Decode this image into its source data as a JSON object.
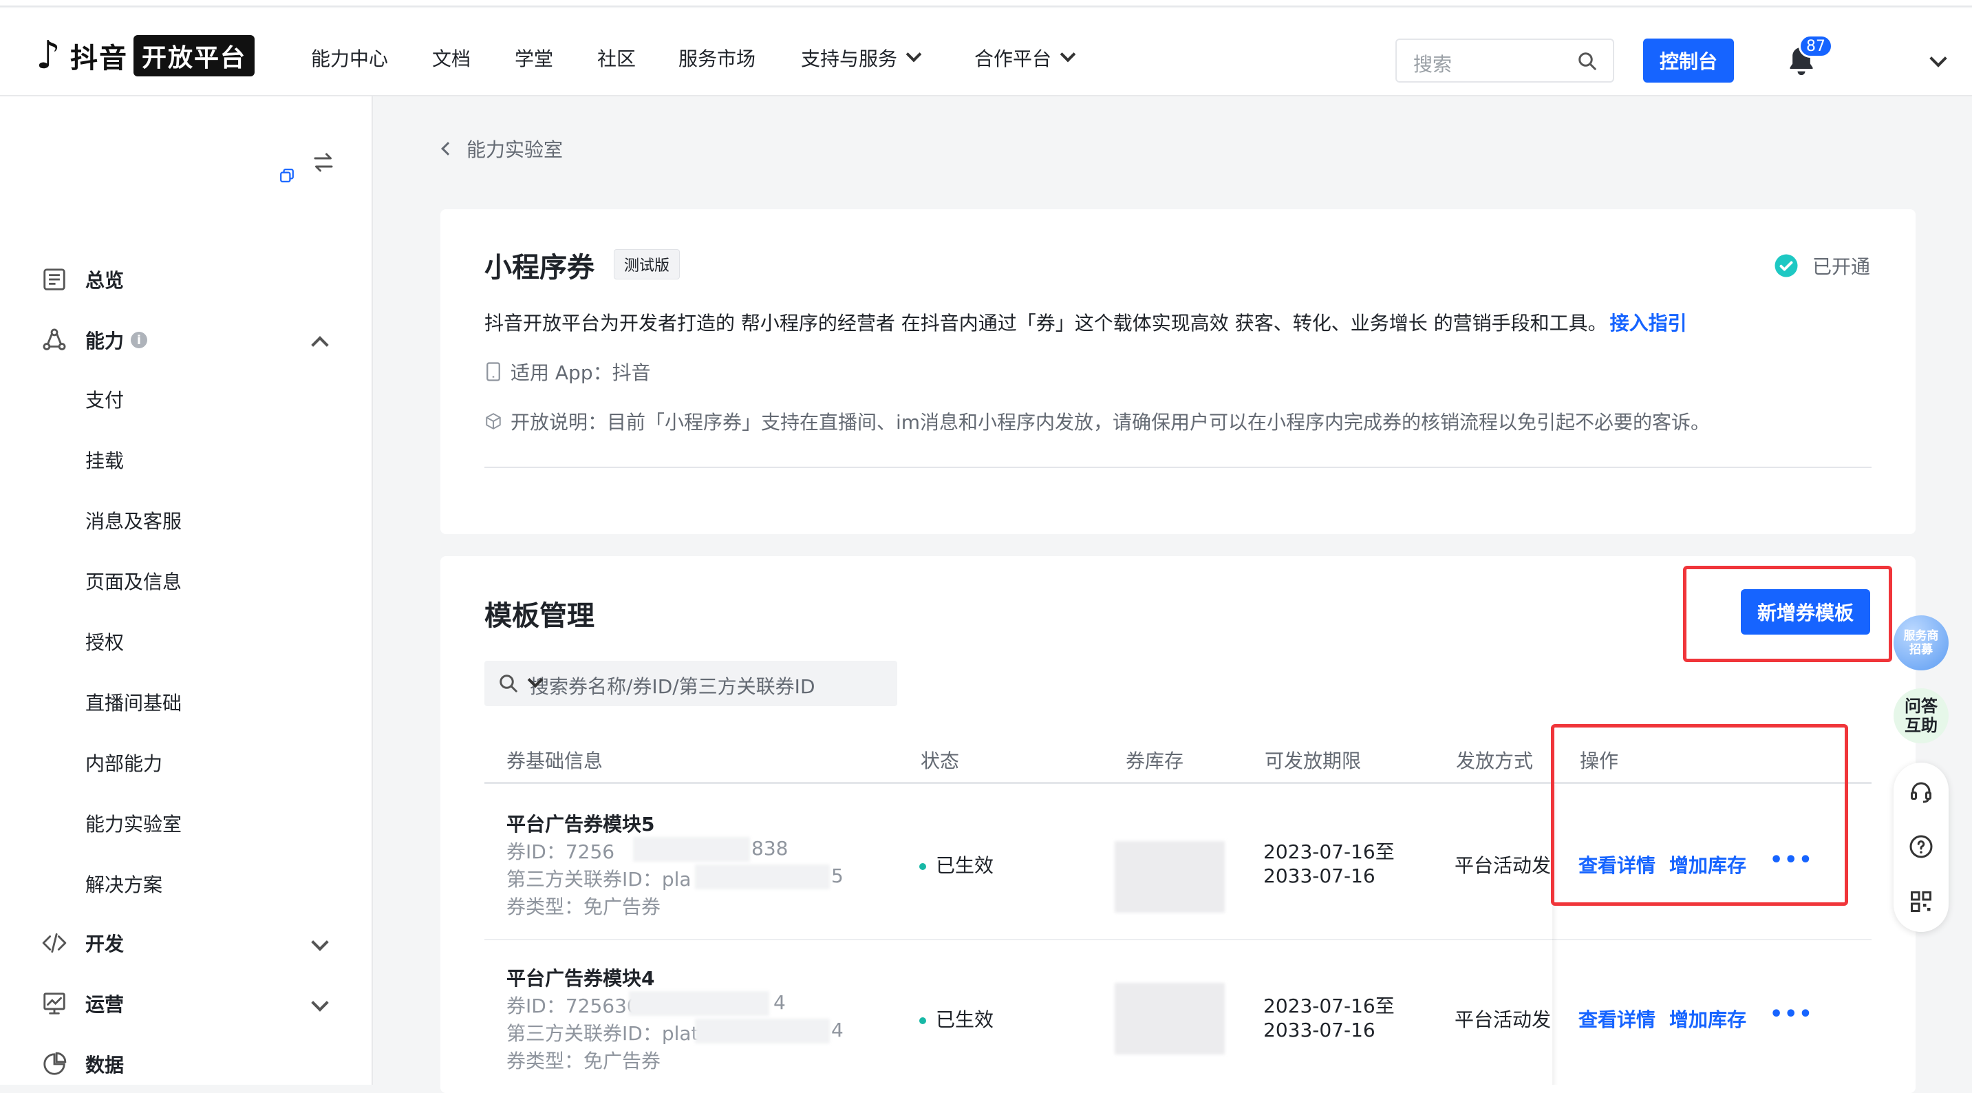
{
  "header": {
    "logo_text": "抖音",
    "logo_badge": "开放平台",
    "nav": [
      {
        "label": "能力中心"
      },
      {
        "label": "文档"
      },
      {
        "label": "学堂"
      },
      {
        "label": "社区"
      },
      {
        "label": "服务市场"
      },
      {
        "label": "支持与服务",
        "dropdown": true
      },
      {
        "label": "合作平台",
        "dropdown": true
      }
    ],
    "search_placeholder": "搜索",
    "console_button": "控制台",
    "notification_count": "87"
  },
  "sidebar": {
    "items": [
      {
        "label": "总览",
        "icon": "dashboard-icon"
      },
      {
        "label": "能力",
        "icon": "capability-icon",
        "expanded": true
      },
      {
        "label": "开发",
        "icon": "code-icon"
      },
      {
        "label": "运营",
        "icon": "operation-icon"
      },
      {
        "label": "数据",
        "icon": "pie-chart-icon"
      }
    ],
    "sub_items": [
      "支付",
      "挂载",
      "消息及客服",
      "页面及信息",
      "授权",
      "直播间基础",
      "内部能力",
      "能力实验室",
      "解决方案"
    ]
  },
  "breadcrumb": {
    "back_label": "能力实验室"
  },
  "intro": {
    "title": "小程序券",
    "tag": "测试版",
    "status": "已开通",
    "description": "抖音开放平台为开发者打造的 帮小程序的经营者 在抖音内通过「券」这个载体实现高效 获客、转化、业务增长 的营销手段和工具。",
    "guide_link": "接入指引",
    "app_label": "适用 App：抖音",
    "open_note": "开放说明：目前「小程序券」支持在直播间、im消息和小程序内发放，请确保用户可以在小程序内完成券的核销流程以免引起不必要的客诉。"
  },
  "templates": {
    "title": "模板管理",
    "new_button": "新增券模板",
    "filter_placeholder": "搜索券名称/券ID/第三方关联券ID",
    "columns": [
      "券基础信息",
      "状态",
      "券库存",
      "可发放期限",
      "发放方式",
      "操作"
    ],
    "rows": [
      {
        "name": "平台广告券模块5",
        "coupon_id_prefix": "券ID：7256",
        "coupon_id_suffix": "838",
        "third_id_prefix": "第三方关联券ID：pla",
        "third_id_suffix": "5",
        "type": "券类型：免广告券",
        "status": "已生效",
        "period_start": "2023-07-16至",
        "period_end": "2033-07-16",
        "method": "平台活动发",
        "action_detail": "查看详情",
        "action_stock": "增加库存",
        "action_more": "•••"
      },
      {
        "name": "平台广告券模块4",
        "coupon_id_prefix": "券ID：725630",
        "coupon_id_suffix": "4",
        "third_id_prefix": "第三方关联券ID：plat",
        "third_id_suffix": "4",
        "type": "券类型：免广告券",
        "status": "已生效",
        "period_start": "2023-07-16至",
        "period_end": "2033-07-16",
        "method": "平台活动发",
        "action_detail": "查看详情",
        "action_stock": "增加库存",
        "action_more": "•••"
      }
    ]
  },
  "floating": {
    "recruit_line1": "服务商",
    "recruit_line2": "招募",
    "qa_line1": "问答",
    "qa_line2": "互助"
  },
  "colors": {
    "primary": "#1664ff",
    "highlight_box": "#f0353a",
    "status_green": "#17b8a6"
  }
}
